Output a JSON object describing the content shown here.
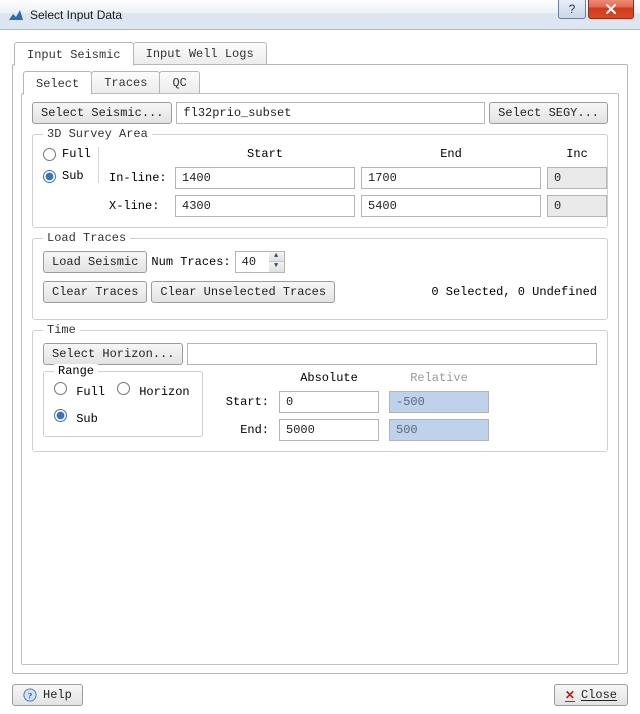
{
  "window": {
    "title": "Select Input Data"
  },
  "outer_tabs": {
    "input_seismic": "Input Seismic",
    "input_well_logs": "Input Well Logs"
  },
  "inner_tabs": {
    "select": "Select",
    "traces": "Traces",
    "qc": "QC"
  },
  "select_seismic": {
    "button": "Select Seismic...",
    "value": "fl32prio_subset",
    "segy_button": "Select SEGY..."
  },
  "survey": {
    "legend": "3D Survey Area",
    "full": "Full",
    "sub": "Sub",
    "hdr_start": "Start",
    "hdr_end": "End",
    "hdr_inc": "Inc",
    "inline_label": "In-line:",
    "xline_label": "X-line:",
    "inline_start": "1400",
    "inline_end": "1700",
    "inline_inc": "0",
    "xline_start": "4300",
    "xline_end": "5400",
    "xline_inc": "0"
  },
  "load": {
    "legend": "Load Traces",
    "load_button": "Load Seismic",
    "num_traces_label": "Num Traces:",
    "num_traces": "40",
    "clear_traces": "Clear Traces",
    "clear_unselected": "Clear Unselected Traces",
    "status": "0 Selected, 0 Undefined"
  },
  "time": {
    "legend": "Time",
    "select_horizon": "Select Horizon...",
    "horizon_value": "",
    "range_legend": "Range",
    "full": "Full",
    "horizon": "Horizon",
    "sub": "Sub",
    "absolute": "Absolute",
    "relative": "Relative",
    "start_label": "Start:",
    "end_label": "End:",
    "abs_start": "0",
    "abs_end": "5000",
    "rel_start": "-500",
    "rel_end": "500"
  },
  "bottom": {
    "help": "Help",
    "close": "Close"
  }
}
